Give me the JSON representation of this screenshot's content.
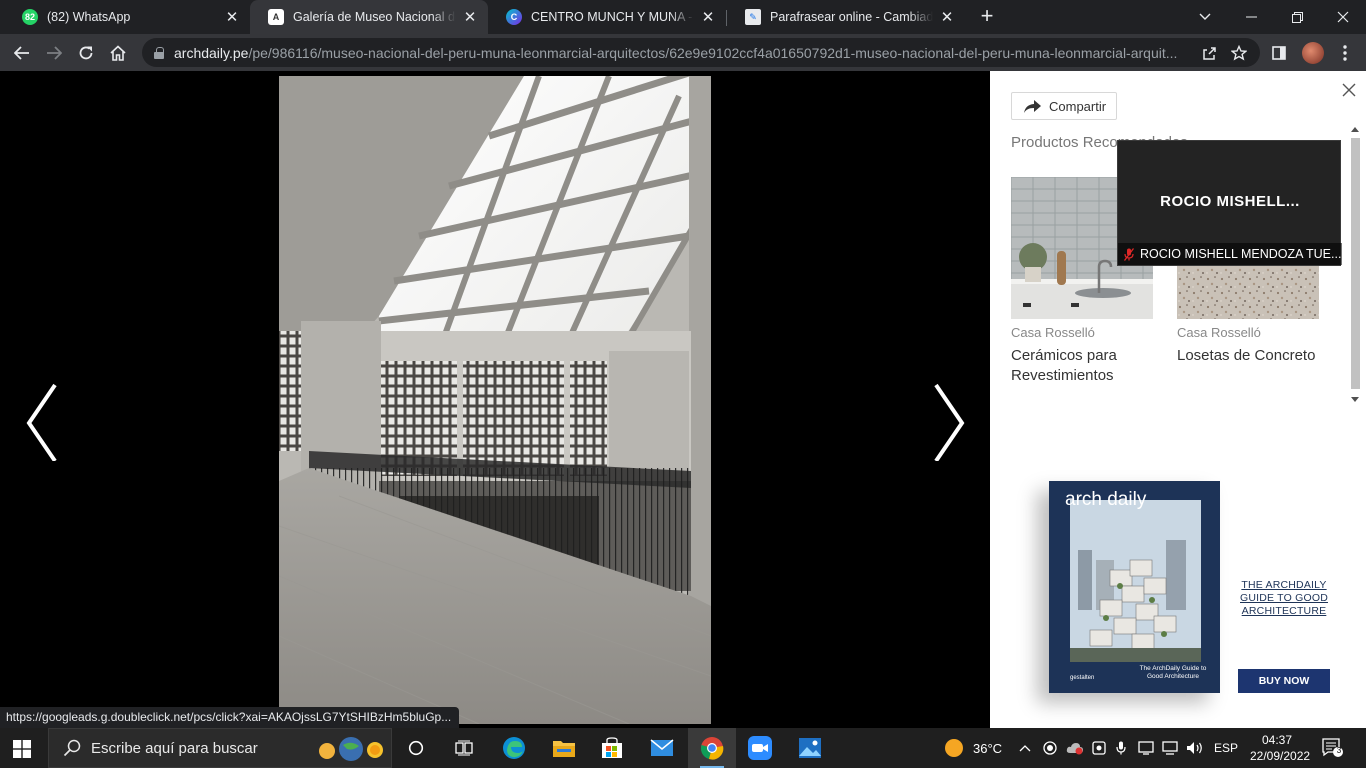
{
  "browser": {
    "tabs": [
      {
        "title": "(82) WhatsApp",
        "badge": "82",
        "active": false
      },
      {
        "title": "Galería de Museo Nacional del Perú",
        "active": true
      },
      {
        "title": "CENTRO MUNCH Y MUNA - Presentación",
        "active": false
      },
      {
        "title": "Parafrasear online - Cambiador de texto",
        "active": false
      }
    ],
    "url_domain": "archdaily.pe",
    "url_path": "/pe/986116/museo-nacional-del-peru-muna-leonmarcial-arquitectos/62e9e9102ccf4a01650792d1-museo-nacional-del-peru-muna-leonmarcial-arquit..."
  },
  "status_bar": {
    "hover_url": "https://googleads.g.doubleclick.net/pcs/click?xai=AKAOjssLG7YtSHIBzHm5bluGp..."
  },
  "sidebar": {
    "share_label": "Compartir",
    "recommended_title": "Productos Recomendados",
    "products": [
      {
        "brand": "Casa Rosselló",
        "name": "Cerámicos para Revestimientos"
      },
      {
        "brand": "Casa Rosselló",
        "name": "Losetas de Concreto"
      }
    ],
    "ad": {
      "book_logo": "arch daily",
      "book_subtitle": "The ArchDaily Guide to Good Architecture",
      "book_publisher": "gestalten",
      "tagline": "THE ARCHDAILY GUIDE TO GOOD ARCHITECTURE",
      "button": "BUY NOW",
      "accent": "#1d3570"
    }
  },
  "video_overlay": {
    "name": "ROCIO  MISHELL...",
    "label": "ROCIO MISHELL MENDOZA TUE..."
  },
  "taskbar": {
    "search_placeholder": "Escribe aquí para buscar",
    "weather": "36°C",
    "language": "ESP",
    "time": "04:37",
    "date": "22/09/2022",
    "notifications": "3"
  }
}
